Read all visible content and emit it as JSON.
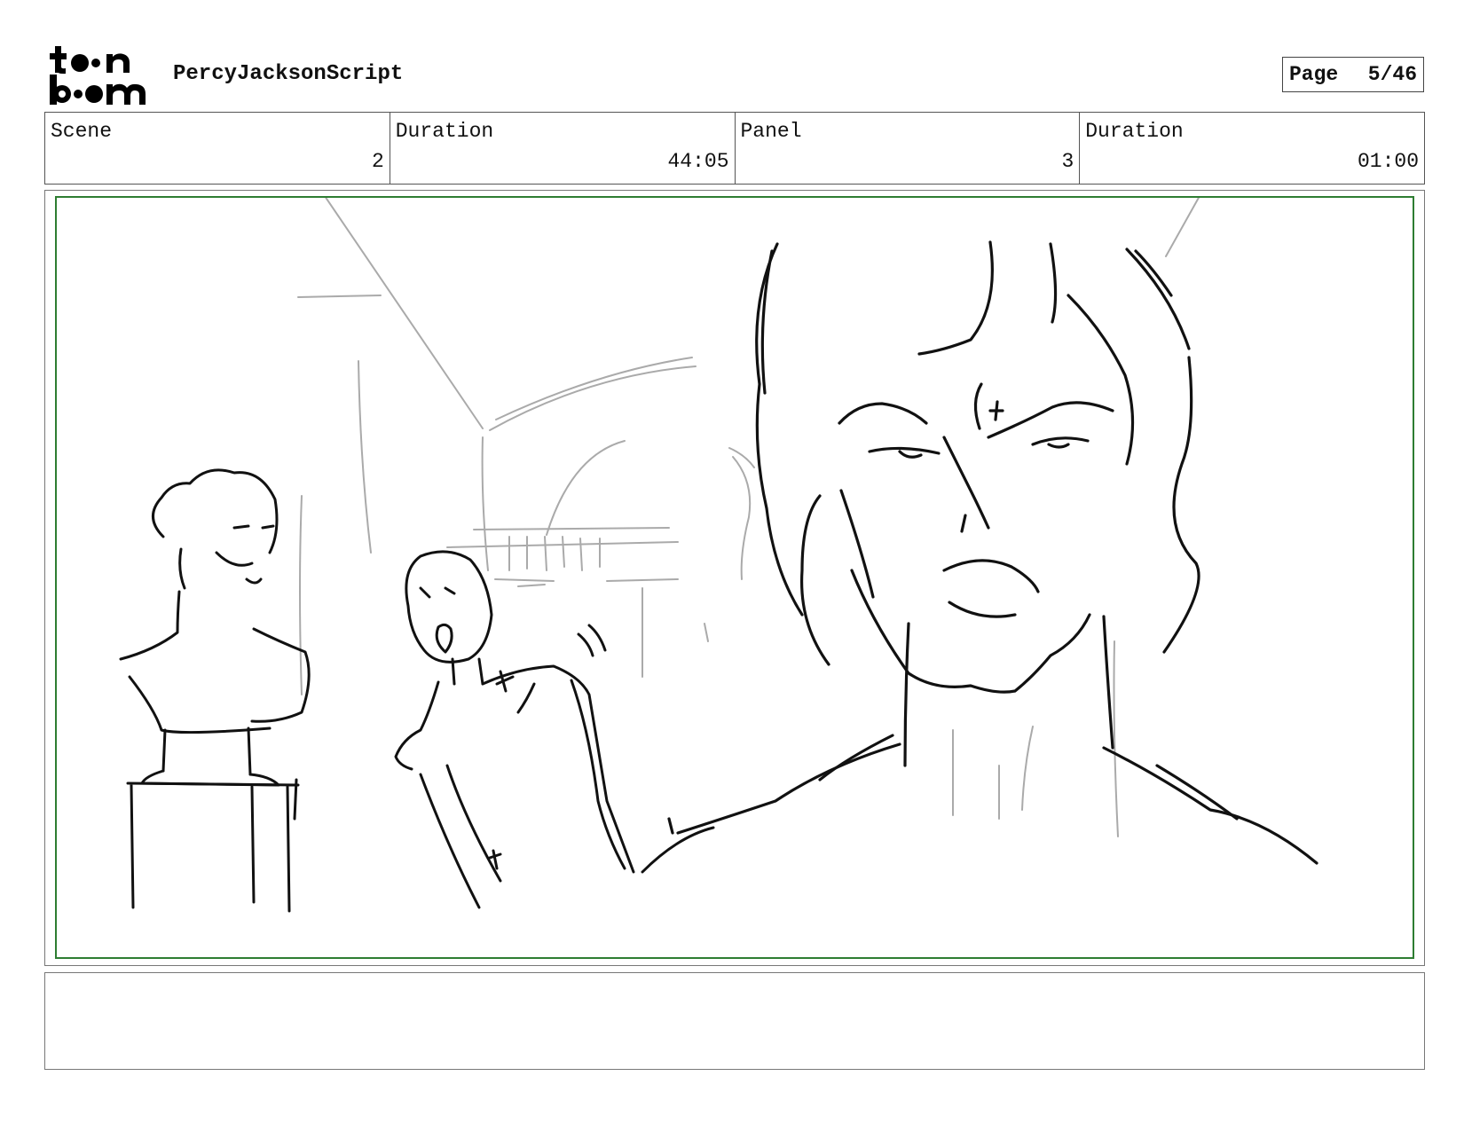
{
  "header": {
    "logo_text": "toon boom",
    "project_title": "PercyJacksonScript"
  },
  "page": {
    "label": "Page",
    "number": "5/46"
  },
  "info": [
    {
      "label": "Scene",
      "value": "2"
    },
    {
      "label": "Duration",
      "value": "44:05"
    },
    {
      "label": "Panel",
      "value": "3"
    },
    {
      "label": "Duration",
      "value": "01:00"
    }
  ],
  "panel": {
    "frame_color": "#2e7d32",
    "sketch_icon": "storyboard-sketch"
  },
  "dialogue": {
    "text": ""
  }
}
